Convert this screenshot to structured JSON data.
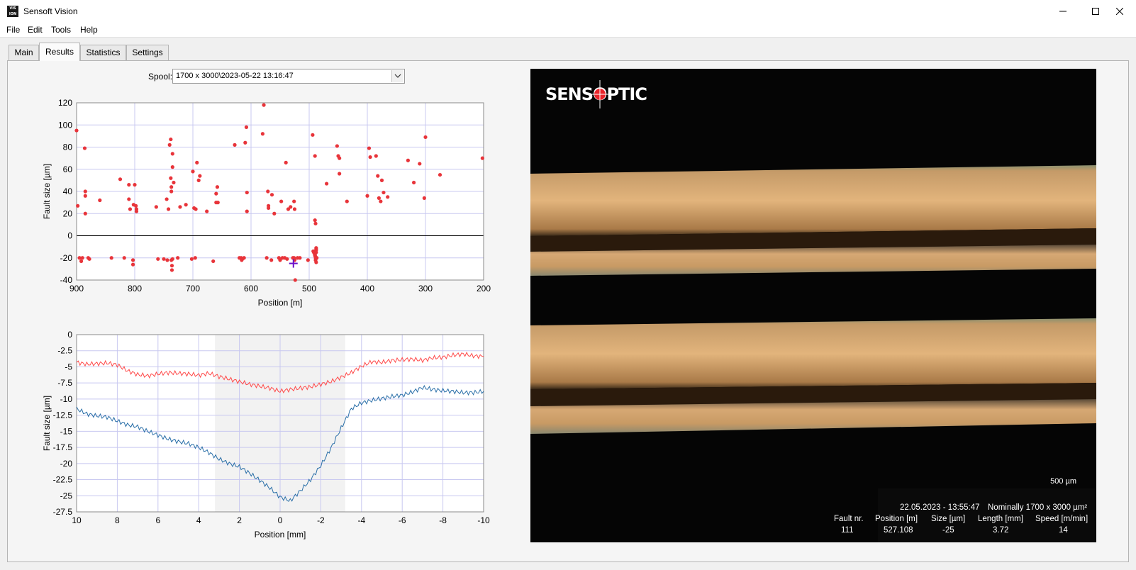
{
  "window": {
    "title": "Sensoft Vision",
    "icon_text": "VIS ION"
  },
  "menu": [
    "File",
    "Edit",
    "Tools",
    "Help"
  ],
  "tabs": [
    "Main",
    "Results",
    "Statistics",
    "Settings"
  ],
  "active_tab": "Results",
  "spool": {
    "label": "Spool:",
    "value": "1700 x 3000\\2023-05-22 13:16:47"
  },
  "chart_data": [
    {
      "type": "scatter",
      "xlabel": "Position [m]",
      "ylabel": "Fault size [µm]",
      "xlim": [
        900,
        200
      ],
      "ylim": [
        -40,
        120
      ],
      "xticks": [
        "900",
        "800",
        "700",
        "600",
        "500",
        "400",
        "300",
        "200"
      ],
      "yticks": [
        "120",
        "100",
        "80",
        "60",
        "40",
        "20",
        "0",
        "-20",
        "-40"
      ],
      "grid": true,
      "color": "#e8343a",
      "cursor": {
        "x": 527.108,
        "y": -25,
        "color": "#6a10c8"
      },
      "points": [
        [
          900,
          95
        ],
        [
          898,
          27
        ],
        [
          895,
          -20
        ],
        [
          892,
          -23
        ],
        [
          890,
          -20
        ],
        [
          886,
          79
        ],
        [
          885,
          40
        ],
        [
          885,
          36
        ],
        [
          885,
          20
        ],
        [
          880,
          -20
        ],
        [
          878,
          -21
        ],
        [
          860,
          32
        ],
        [
          840,
          -20
        ],
        [
          825,
          51
        ],
        [
          818,
          -20
        ],
        [
          810,
          46
        ],
        [
          810,
          33
        ],
        [
          808,
          24
        ],
        [
          803,
          -22
        ],
        [
          803,
          -26
        ],
        [
          802,
          28
        ],
        [
          800,
          46
        ],
        [
          798,
          27
        ],
        [
          797,
          22
        ],
        [
          797,
          24
        ],
        [
          763,
          26
        ],
        [
          760,
          -21
        ],
        [
          750,
          -21
        ],
        [
          745,
          33
        ],
        [
          744,
          -22
        ],
        [
          742,
          24
        ],
        [
          740,
          82
        ],
        [
          738,
          87
        ],
        [
          738,
          52
        ],
        [
          737,
          44
        ],
        [
          737,
          40
        ],
        [
          737,
          -22
        ],
        [
          736,
          -27
        ],
        [
          736,
          -31
        ],
        [
          735,
          74
        ],
        [
          735,
          62
        ],
        [
          735,
          -21
        ],
        [
          733,
          48
        ],
        [
          726,
          -20
        ],
        [
          722,
          26
        ],
        [
          712,
          28
        ],
        [
          702,
          -21
        ],
        [
          700,
          58
        ],
        [
          698,
          25
        ],
        [
          696,
          -20
        ],
        [
          695,
          24
        ],
        [
          693,
          66
        ],
        [
          690,
          50
        ],
        [
          688,
          54
        ],
        [
          676,
          22
        ],
        [
          665,
          -23
        ],
        [
          660,
          30
        ],
        [
          660,
          38
        ],
        [
          658,
          44
        ],
        [
          657,
          30
        ],
        [
          628,
          82
        ],
        [
          620,
          -20
        ],
        [
          617,
          -20
        ],
        [
          616,
          -22
        ],
        [
          615,
          -21
        ],
        [
          612,
          -20
        ],
        [
          610,
          84
        ],
        [
          608,
          98
        ],
        [
          607,
          39
        ],
        [
          607,
          22
        ],
        [
          580,
          92
        ],
        [
          578,
          118
        ],
        [
          573,
          -20
        ],
        [
          571,
          40
        ],
        [
          570,
          27
        ],
        [
          570,
          25
        ],
        [
          565,
          -22
        ],
        [
          564,
          37
        ],
        [
          560,
          20
        ],
        [
          552,
          -20
        ],
        [
          550,
          -22
        ],
        [
          548,
          31
        ],
        [
          546,
          -20
        ],
        [
          542,
          -20
        ],
        [
          540,
          66
        ],
        [
          538,
          -21
        ],
        [
          536,
          24
        ],
        [
          532,
          26
        ],
        [
          528,
          -20
        ],
        [
          526,
          -20
        ],
        [
          526,
          31
        ],
        [
          525,
          24
        ],
        [
          525,
          -22
        ],
        [
          524,
          -40
        ],
        [
          520,
          -20
        ],
        [
          516,
          -20
        ],
        [
          502,
          -22
        ],
        [
          494,
          91
        ],
        [
          493,
          -14
        ],
        [
          492,
          -15
        ],
        [
          491,
          -16
        ],
        [
          490,
          -17
        ],
        [
          490,
          -18
        ],
        [
          489,
          -19
        ],
        [
          489,
          -20
        ],
        [
          489,
          -22
        ],
        [
          488,
          -24
        ],
        [
          490,
          72
        ],
        [
          490,
          14
        ],
        [
          489,
          11
        ],
        [
          488,
          -11
        ],
        [
          488,
          -13
        ],
        [
          488,
          -12
        ],
        [
          488,
          -15
        ],
        [
          487,
          -20
        ],
        [
          470,
          47
        ],
        [
          452,
          81
        ],
        [
          450,
          72
        ],
        [
          448,
          70
        ],
        [
          448,
          56
        ],
        [
          435,
          31
        ],
        [
          400,
          36
        ],
        [
          397,
          79
        ],
        [
          395,
          71
        ],
        [
          385,
          72
        ],
        [
          382,
          54
        ],
        [
          380,
          34
        ],
        [
          377,
          31
        ],
        [
          375,
          50
        ],
        [
          372,
          39
        ],
        [
          365,
          35
        ],
        [
          330,
          68
        ],
        [
          320,
          48
        ],
        [
          310,
          65
        ],
        [
          302,
          34
        ],
        [
          300,
          89
        ],
        [
          275,
          55
        ],
        [
          202,
          70
        ]
      ]
    },
    {
      "type": "line",
      "xlabel": "Position [mm]",
      "ylabel": "Fault size [µm]",
      "xlim": [
        10,
        -10
      ],
      "ylim": [
        -27.5,
        0
      ],
      "xticks": [
        "10",
        "8",
        "6",
        "4",
        "2",
        "0",
        "-2",
        "-4",
        "-6",
        "-8",
        "-10"
      ],
      "yticks": [
        "0",
        "-2.5",
        "-5",
        "-7.5",
        "-10",
        "-12.5",
        "-15",
        "-17.5",
        "-20",
        "-22.5",
        "-25",
        "-27.5"
      ],
      "grid": true,
      "shaded_region": [
        3.2,
        -3.2
      ],
      "series": [
        {
          "color": "#ff4a4a",
          "x": [
            10,
            9.5,
            9,
            8.5,
            8,
            7.5,
            7,
            6.5,
            6,
            5.5,
            5,
            4.5,
            4,
            3.5,
            3,
            2.5,
            2,
            1.5,
            1,
            0.5,
            0,
            -0.5,
            -1,
            -1.5,
            -2,
            -2.5,
            -3,
            -3.5,
            -4,
            -4.5,
            -5,
            -5.5,
            -6,
            -6.5,
            -7,
            -7.5,
            -8,
            -8.5,
            -9,
            -9.5,
            -10
          ],
          "values": [
            -4.3,
            -4.6,
            -4.5,
            -4.4,
            -4.7,
            -5.6,
            -6.2,
            -6.4,
            -6.1,
            -5.9,
            -6.0,
            -6.1,
            -6.3,
            -6.0,
            -6.5,
            -6.9,
            -7.3,
            -7.7,
            -8.0,
            -8.3,
            -8.8,
            -8.5,
            -8.3,
            -8.1,
            -7.7,
            -7.3,
            -6.6,
            -5.9,
            -4.9,
            -4.2,
            -4.3,
            -4.0,
            -3.9,
            -3.8,
            -4.0,
            -3.6,
            -3.5,
            -3.2,
            -3.0,
            -3.3,
            -3.4
          ]
        },
        {
          "color": "#2a6fa8",
          "x": [
            10,
            9.5,
            9,
            8.5,
            8,
            7.5,
            7,
            6.5,
            6,
            5.5,
            5,
            4.5,
            4,
            3.5,
            3,
            2.5,
            2,
            1.5,
            1,
            0.5,
            0,
            -0.5,
            -1,
            -1.5,
            -2,
            -2.5,
            -3,
            -3.5,
            -4,
            -4.5,
            -5,
            -5.5,
            -6,
            -6.5,
            -7,
            -7.5,
            -8,
            -8.5,
            -9,
            -9.5,
            -10
          ],
          "values": [
            -11.5,
            -12.3,
            -12.6,
            -12.8,
            -13.4,
            -14.0,
            -14.3,
            -15.0,
            -15.6,
            -16.2,
            -16.6,
            -16.9,
            -17.5,
            -18.3,
            -19.3,
            -20.0,
            -20.5,
            -21.5,
            -22.6,
            -23.8,
            -25.2,
            -25.8,
            -24.2,
            -22.5,
            -20.3,
            -17.6,
            -14.5,
            -11.5,
            -10.6,
            -10.2,
            -9.9,
            -9.6,
            -9.4,
            -8.9,
            -8.2,
            -8.5,
            -8.7,
            -8.8,
            -9.0,
            -9.0,
            -8.8
          ]
        }
      ]
    }
  ],
  "image_panel": {
    "logo": "SENSOPTIC",
    "scale": "500 µm",
    "info": {
      "datetime": "22.05.2023 - 13:55:47",
      "nominal": "Nominally 1700 x 3000 µm²",
      "headers": [
        "Fault nr.",
        "Position [m]",
        "Size [µm]",
        "Length [mm]",
        "Speed [m/min]"
      ],
      "values": [
        "111",
        "527.108",
        "-25",
        "3.72",
        "14"
      ]
    }
  }
}
